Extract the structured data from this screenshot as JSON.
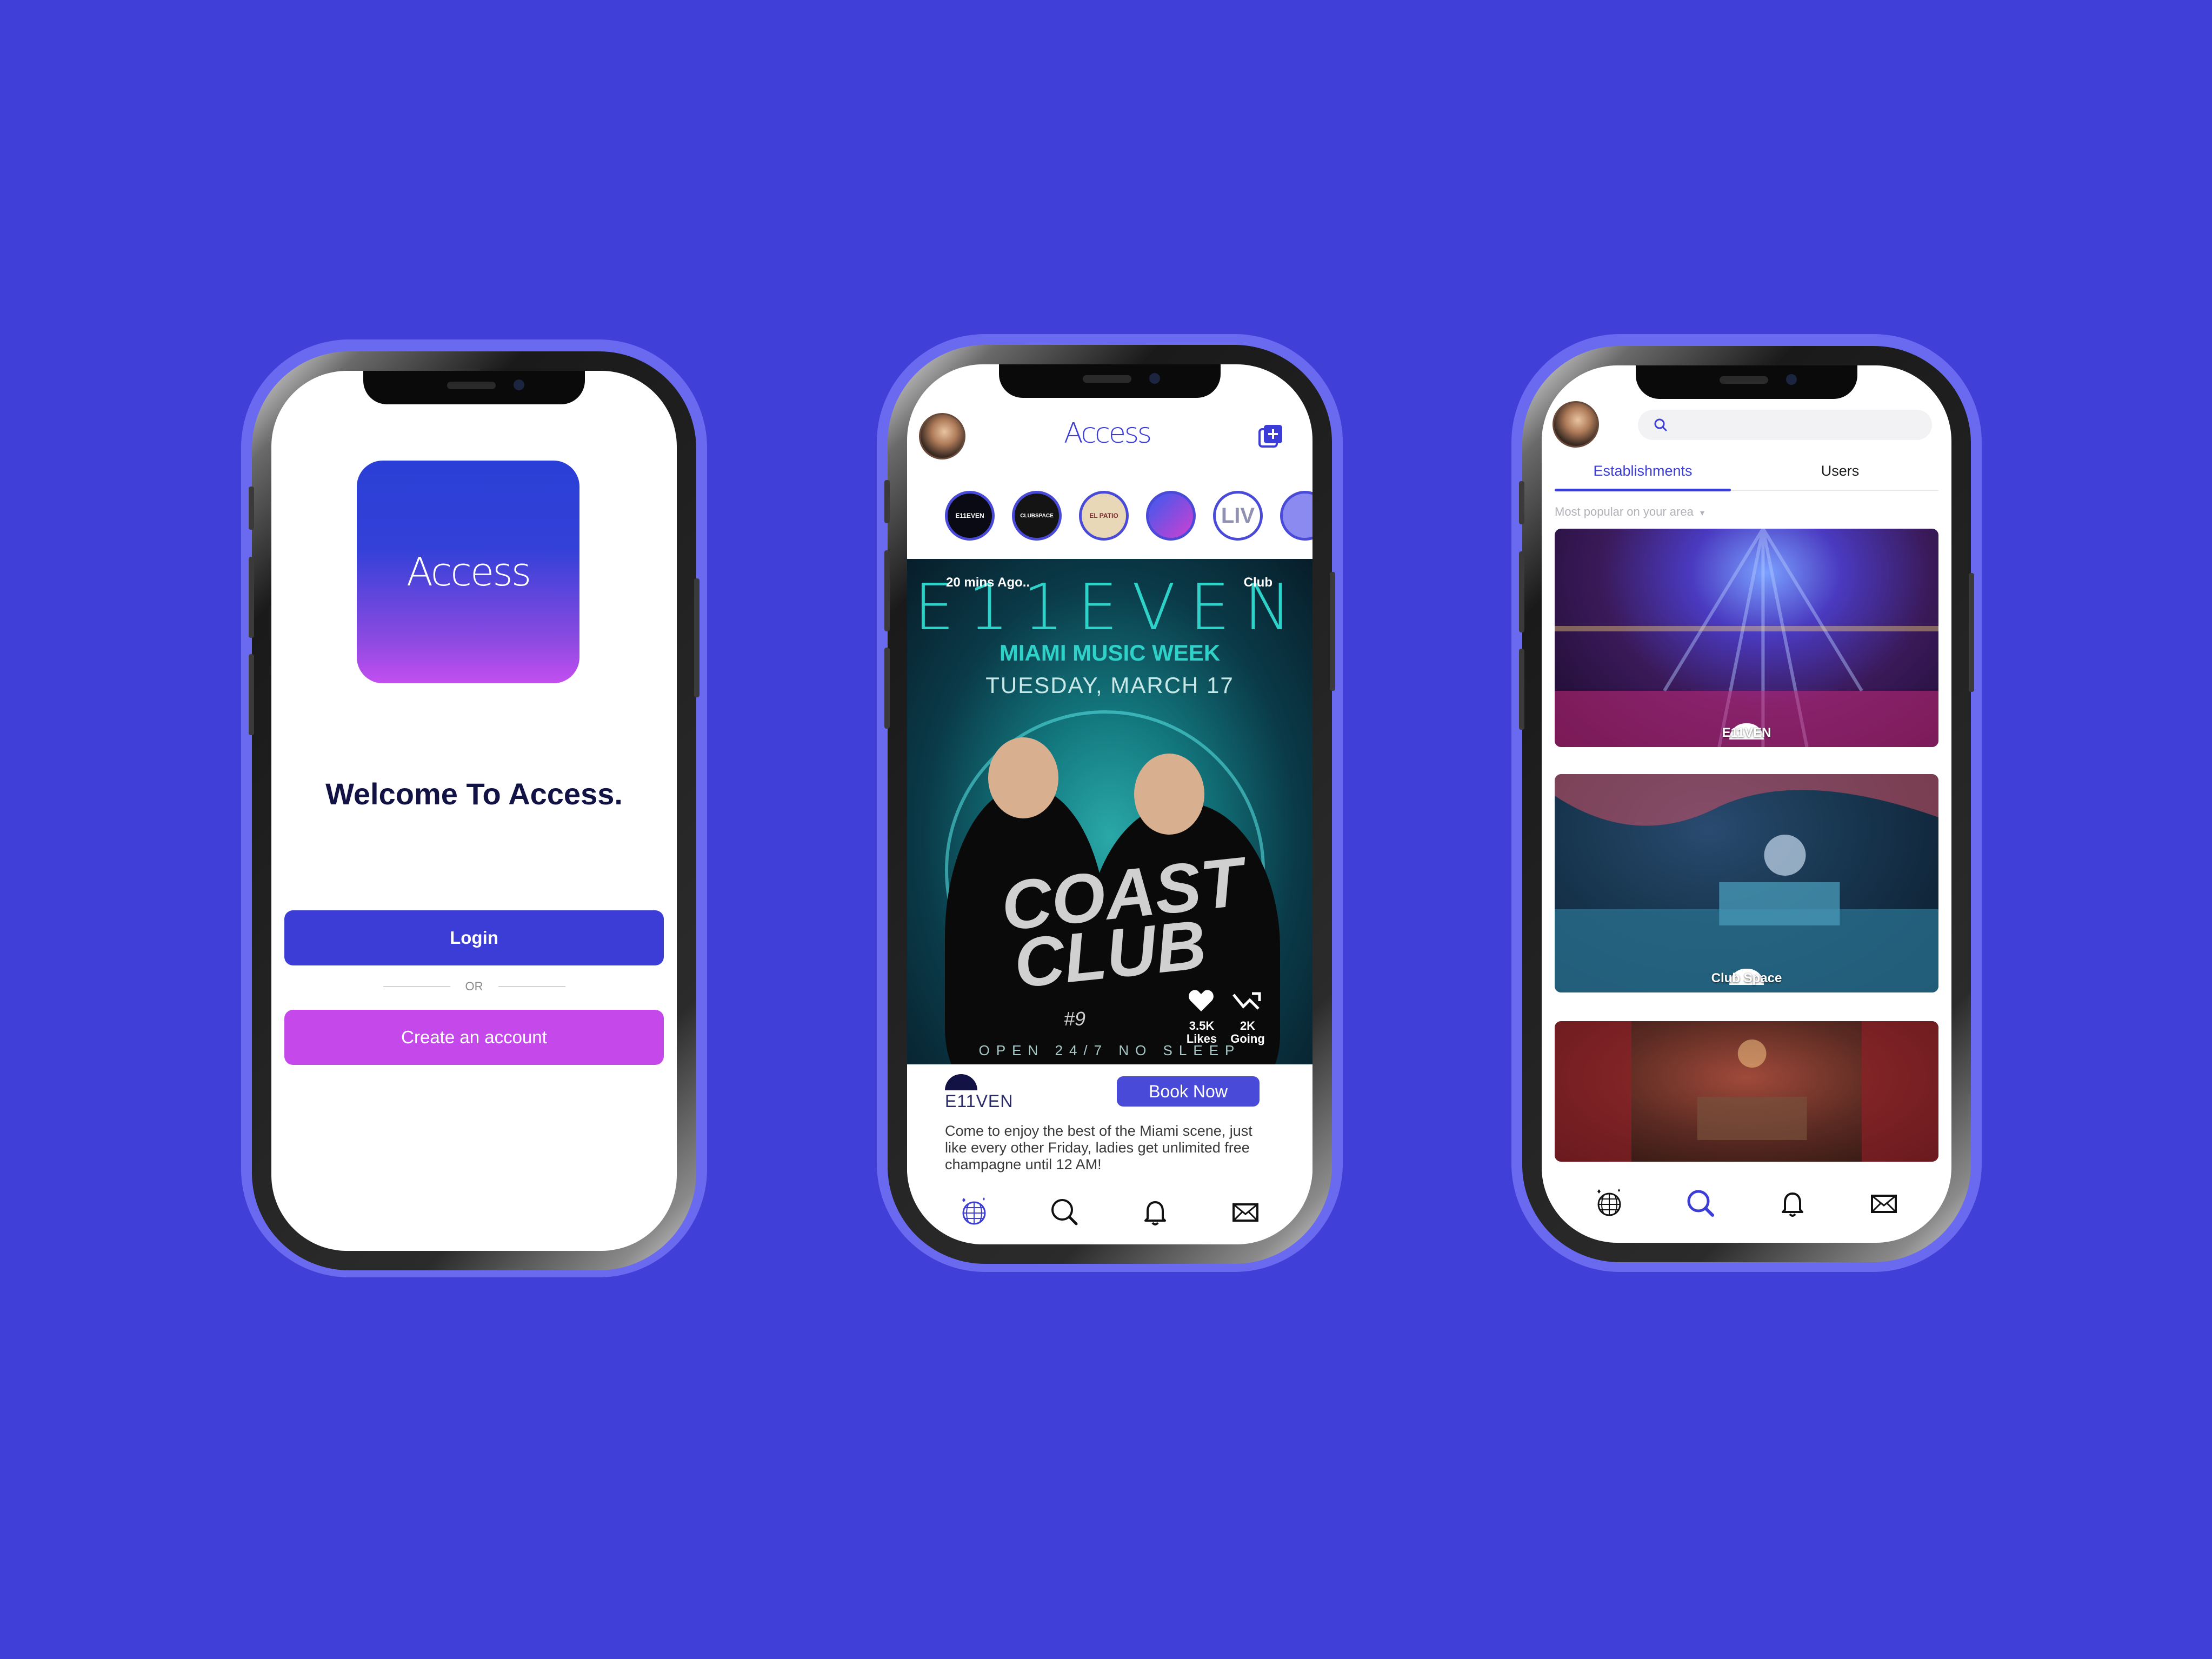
{
  "colors": {
    "background": "#4040d8",
    "primary": "#3c3cd6",
    "accent": "#c448ea",
    "title_dark": "#121245"
  },
  "phone1": {
    "logo_text": "Access",
    "welcome": "Welcome To Access.",
    "login_label": "Login",
    "or_label": "OR",
    "create_label": "Create an account"
  },
  "phone2": {
    "app_title": "Access",
    "stories": [
      {
        "label": "E11EVEN"
      },
      {
        "label": "CLUBSPACE"
      },
      {
        "label": "EL PATIO"
      },
      {
        "label": ""
      },
      {
        "label": "LIV"
      },
      {
        "label": ""
      }
    ],
    "post": {
      "time_ago": "20 mins Ago..",
      "tag": "Club",
      "poster_brand": "E11EVEN",
      "poster_event": "MIAMI MUSIC WEEK",
      "poster_date": "TUESDAY, MARCH 17",
      "poster_headline": "COAST CLUB",
      "poster_rank": "#9",
      "poster_footer": "OPEN 24/7 NO SLEEP",
      "likes_count": "3.5K",
      "likes_label": "Likes",
      "going_count": "2K",
      "going_label": "Going",
      "venue_name": "E11VEN",
      "book_label": "Book Now",
      "description": "Come to enjoy the best of the Miami scene, just like every other Friday, ladies get unlimited free champagne until 12 AM!"
    },
    "tabs": [
      {
        "icon": "disco-ball-icon",
        "active": true
      },
      {
        "icon": "search-icon",
        "active": false
      },
      {
        "icon": "bell-icon",
        "active": false
      },
      {
        "icon": "mail-icon",
        "active": false
      }
    ]
  },
  "phone3": {
    "search_placeholder": "",
    "segments": [
      "Establishments",
      "Users"
    ],
    "active_segment": "Establishments",
    "filter_label": "Most popular on your area",
    "cards": [
      {
        "label": "E11VEN"
      },
      {
        "label": "Club Space"
      },
      {
        "label": ""
      }
    ],
    "tabs": [
      {
        "icon": "disco-ball-icon",
        "active": false
      },
      {
        "icon": "search-icon",
        "active": true
      },
      {
        "icon": "bell-icon",
        "active": false
      },
      {
        "icon": "mail-icon",
        "active": false
      }
    ]
  }
}
